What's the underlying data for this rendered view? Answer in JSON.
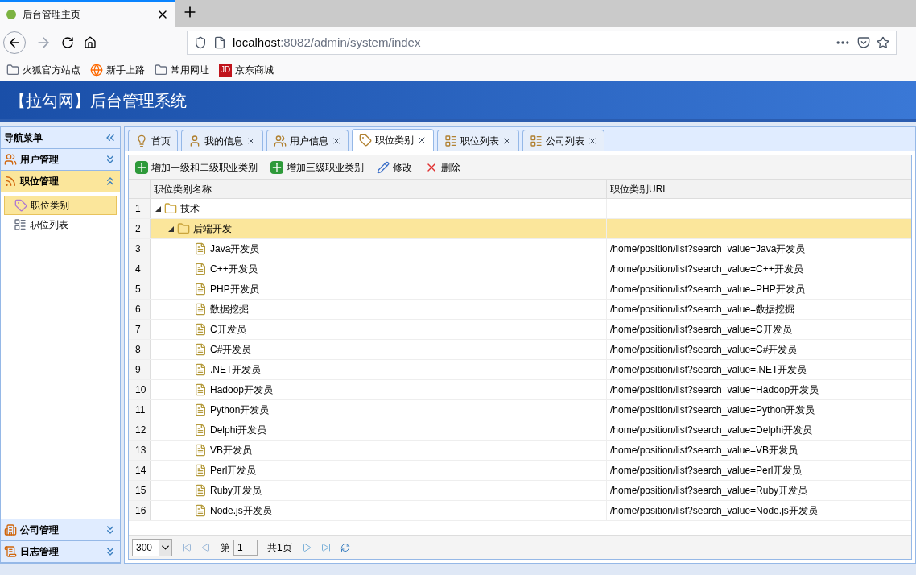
{
  "browser": {
    "tab_title": "后台管理主页",
    "url_host": "localhost",
    "url_path": ":8082/admin/system/index",
    "bookmarks": [
      {
        "label": "火狐官方站点",
        "kind": "folder"
      },
      {
        "label": "新手上路",
        "kind": "globe"
      },
      {
        "label": "常用网址",
        "kind": "folder"
      },
      {
        "label": "京东商城",
        "kind": "jd",
        "badge": "JD"
      }
    ]
  },
  "app_title": "【拉勾网】后台管理系统",
  "sidebar": {
    "title": "导航菜单",
    "sections": [
      {
        "label": "用户管理",
        "expanded": false
      },
      {
        "label": "职位管理",
        "expanded": true,
        "items": [
          {
            "label": "职位类别",
            "selected": true
          },
          {
            "label": "职位列表",
            "selected": false
          }
        ]
      },
      {
        "label": "公司管理",
        "expanded": false
      },
      {
        "label": "日志管理",
        "expanded": false
      }
    ]
  },
  "tabs": [
    {
      "label": "首页",
      "selected": false,
      "closable": false
    },
    {
      "label": "我的信息",
      "selected": false,
      "closable": true
    },
    {
      "label": "用户信息",
      "selected": false,
      "closable": true
    },
    {
      "label": "职位类别",
      "selected": true,
      "closable": true
    },
    {
      "label": "职位列表",
      "selected": false,
      "closable": true
    },
    {
      "label": "公司列表",
      "selected": false,
      "closable": true
    }
  ],
  "toolbar": [
    {
      "label": "增加一级和二级职业类别",
      "kind": "add"
    },
    {
      "label": "增加三级职业类别",
      "kind": "add"
    },
    {
      "label": "修改",
      "kind": "edit"
    },
    {
      "label": "删除",
      "kind": "delete"
    }
  ],
  "table": {
    "columns": [
      "职位类别名称",
      "职位类别URL"
    ],
    "rows": [
      {
        "number": "1",
        "name": "技术",
        "expanded": true,
        "selected": false,
        "children": [
          {
            "number": "2",
            "name": "后端开发",
            "expanded": true,
            "selected": true,
            "children": [
              {
                "number": "3",
                "name": "Java开发员",
                "url": "/home/position/list?search_value=Java开发员",
                "selected": false
              },
              {
                "number": "4",
                "name": "C++开发员",
                "url": "/home/position/list?search_value=C++开发员",
                "selected": false
              },
              {
                "number": "5",
                "name": "PHP开发员",
                "url": "/home/position/list?search_value=PHP开发员",
                "selected": false
              },
              {
                "number": "6",
                "name": "数据挖掘",
                "url": "/home/position/list?search_value=数据挖掘",
                "selected": false
              },
              {
                "number": "7",
                "name": "C开发员",
                "url": "/home/position/list?search_value=C开发员",
                "selected": false
              },
              {
                "number": "8",
                "name": "C#开发员",
                "url": "/home/position/list?search_value=C#开发员",
                "selected": false
              },
              {
                "number": "9",
                "name": ".NET开发员",
                "url": "/home/position/list?search_value=.NET开发员",
                "selected": false
              },
              {
                "number": "10",
                "name": "Hadoop开发员",
                "url": "/home/position/list?search_value=Hadoop开发员",
                "selected": false
              },
              {
                "number": "11",
                "name": "Python开发员",
                "url": "/home/position/list?search_value=Python开发员",
                "selected": false
              },
              {
                "number": "12",
                "name": "Delphi开发员",
                "url": "/home/position/list?search_value=Delphi开发员",
                "selected": false
              },
              {
                "number": "13",
                "name": "VB开发员",
                "url": "/home/position/list?search_value=VB开发员",
                "selected": false
              },
              {
                "number": "14",
                "name": "Perl开发员",
                "url": "/home/position/list?search_value=Perl开发员",
                "selected": false
              },
              {
                "number": "15",
                "name": "Ruby开发员",
                "url": "/home/position/list?search_value=Ruby开发员",
                "selected": false
              },
              {
                "number": "16",
                "name": "Node.js开发员",
                "url": "/home/position/list?search_value=Node.js开发员",
                "selected": false
              }
            ]
          }
        ]
      }
    ]
  },
  "pager": {
    "page_size": "300",
    "page_prefix": "第",
    "page": "1",
    "total": "共1页"
  }
}
